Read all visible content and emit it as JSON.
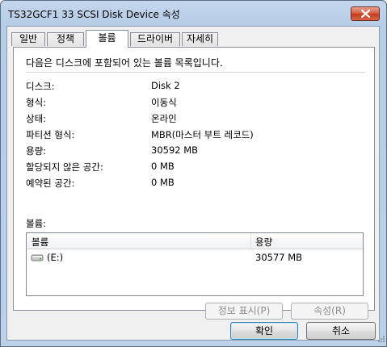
{
  "window": {
    "title": "TS32GCF1 33 SCSI Disk Device 속성"
  },
  "tabs": [
    {
      "label": "일반"
    },
    {
      "label": "정책"
    },
    {
      "label": "볼륨"
    },
    {
      "label": "드라이버"
    },
    {
      "label": "자세히"
    }
  ],
  "active_tab": "볼륨",
  "panel": {
    "description": "다음은 디스크에 포함되어 있는 볼륨 목록입니다.",
    "properties": [
      {
        "label": "디스크:",
        "value": "Disk 2"
      },
      {
        "label": "형식:",
        "value": "이동식"
      },
      {
        "label": "상태:",
        "value": "온라인"
      },
      {
        "label": "파티션 형식:",
        "value": "MBR(마스터 부트 레코드)"
      },
      {
        "label": "용량:",
        "value": "30592 MB"
      },
      {
        "label": "할당되지 않은 공간:",
        "value": "0 MB"
      },
      {
        "label": "예약된 공간:",
        "value": "0 MB"
      }
    ],
    "volumes_label": "볼륨:",
    "volume_list": {
      "columns": [
        "볼륨",
        "용량"
      ],
      "rows": [
        {
          "volume": "(E:)",
          "capacity": "30577 MB",
          "icon": "drive-icon"
        }
      ]
    },
    "buttons": {
      "properties_info": "정보 표시(P)",
      "attributes": "속성(R)"
    }
  },
  "footer": {
    "ok": "확인",
    "cancel": "취소"
  }
}
